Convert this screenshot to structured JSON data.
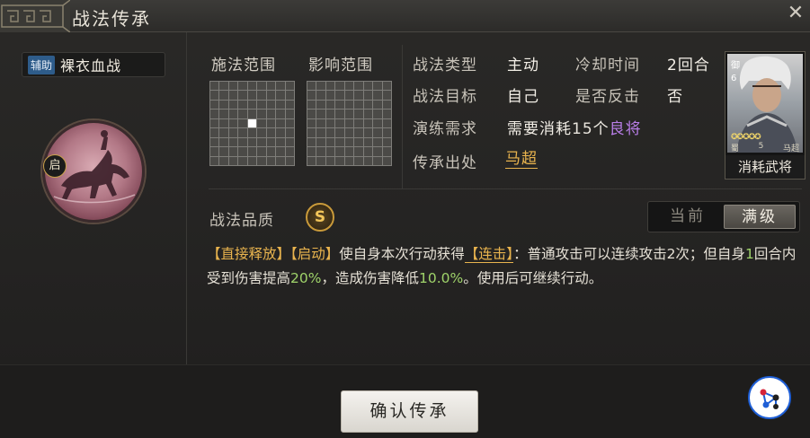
{
  "window": {
    "title": "战法传承",
    "close": "✕"
  },
  "tactic": {
    "type": "辅助",
    "name": "裸衣血战",
    "start_badge": "启"
  },
  "ranges": {
    "cast_label": "施法范围",
    "effect_label": "影响范围"
  },
  "info": {
    "rows": [
      {
        "label": "战法类型",
        "value": "主动"
      },
      {
        "label": "冷却时间",
        "value": "2回合"
      },
      {
        "label": "战法目标",
        "value": "自己"
      },
      {
        "label": "是否反击",
        "value": "否"
      },
      {
        "label": "演练需求",
        "value_prefix": "需要消耗",
        "value_num": "15",
        "value_mid": "个",
        "value_tag": "良将"
      },
      {
        "label": "传承出处",
        "value": "马超"
      }
    ]
  },
  "general_card": {
    "rank": "御",
    "level": "6",
    "stars": "✪✪✪✪✪",
    "faction": "蜀",
    "cost": "5",
    "name": "马超",
    "caption": "消耗武将"
  },
  "quality": {
    "label": "战法品质",
    "grade": "S"
  },
  "level_toggle": {
    "current": "当前",
    "max": "满级",
    "selected": "满级"
  },
  "description": {
    "p1": "【直接释放】",
    "p2": "【启动】",
    "p3": "使自身本次行动获得",
    "p4": "【连击】",
    "p5": "：普通攻击可以连续攻击2次；但自身",
    "p6": "1",
    "p7": "回合内受到伤害提高",
    "p8": "20%",
    "p9": "，造成伤害降低",
    "p10": "10.0%",
    "p11": "。使用后可继续行动。"
  },
  "actions": {
    "confirm": "确认传承"
  },
  "colors": {
    "accent": "#e9b44e",
    "tag_blue": "#2e5c8a",
    "purple": "#b97ee8",
    "green": "#9fd36a"
  }
}
